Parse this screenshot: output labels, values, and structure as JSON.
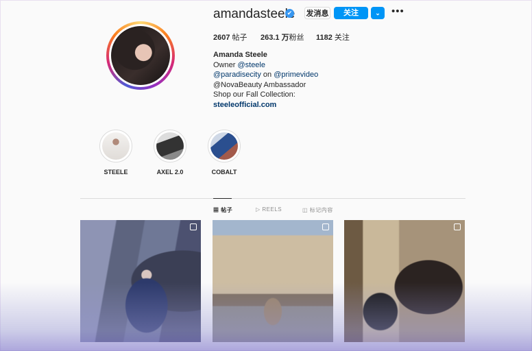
{
  "profile": {
    "username": "amandasteele",
    "verified_icon": "✔",
    "message_button": "发消息",
    "follow_button": "关注",
    "more_button": "⌄",
    "options_icon": "•••",
    "stats": {
      "posts_value": "2607",
      "posts_label": " 帖子",
      "followers_value": "263.1 万",
      "followers_label": "粉丝",
      "following_value": "1182",
      "following_label": " 关注"
    },
    "bio": {
      "name": "Amanda Steele",
      "line1_prefix": "Owner ",
      "line1_link": "@steele",
      "line2_link1": "@paradisecity",
      "line2_mid": " on ",
      "line2_link2": "@primevideo",
      "line3": "@NovaBeauty Ambassador",
      "line4": "Shop our Fall Collection:",
      "website": "steeleofficial.com"
    }
  },
  "highlights": [
    {
      "label": "STEELE"
    },
    {
      "label": "AXEL 2.0"
    },
    {
      "label": "COBALT"
    }
  ],
  "tabs": [
    {
      "icon": "▦",
      "label": "帖子"
    },
    {
      "icon": "▷",
      "label": "REELS"
    },
    {
      "icon": "◫",
      "label": "标记内容"
    }
  ],
  "colors": {
    "accent": "#0095f6",
    "link": "#00376b",
    "verified": "#3897f0"
  }
}
